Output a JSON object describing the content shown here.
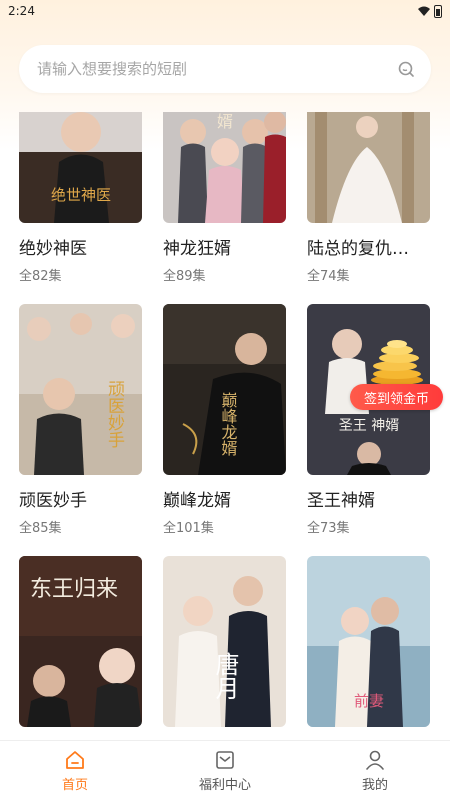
{
  "status_bar": {
    "time": "2:24"
  },
  "search": {
    "placeholder": "请输入想要搜索的短剧"
  },
  "dramas": [
    {
      "title": "绝妙神医",
      "count": "全82集",
      "poster_text": "绝世神医"
    },
    {
      "title": "神龙狂婿",
      "count": "全89集",
      "poster_text": "婿"
    },
    {
      "title": "陆总的复仇…",
      "count": "全74集",
      "poster_text": ""
    },
    {
      "title": "顽医妙手",
      "count": "全85集",
      "poster_text": "顽医妙手"
    },
    {
      "title": "巅峰龙婿",
      "count": "全101集",
      "poster_text": "巅峰龙婿"
    },
    {
      "title": "圣王神婿",
      "count": "全73集",
      "poster_text": "圣王 神婿"
    },
    {
      "title": "",
      "count": "",
      "poster_text": "东王归来"
    },
    {
      "title": "",
      "count": "",
      "poster_text": "唐月"
    },
    {
      "title": "",
      "count": "",
      "poster_text": "前妻"
    }
  ],
  "promo": {
    "label": "签到领金币"
  },
  "tabs": [
    {
      "label": "首页",
      "icon": "home-icon",
      "active": true
    },
    {
      "label": "福利中心",
      "icon": "gift-icon",
      "active": false
    },
    {
      "label": "我的",
      "icon": "user-icon",
      "active": false
    }
  ],
  "colors": {
    "accent": "#ff7a1a",
    "promo_red": "#ff3b3b"
  }
}
